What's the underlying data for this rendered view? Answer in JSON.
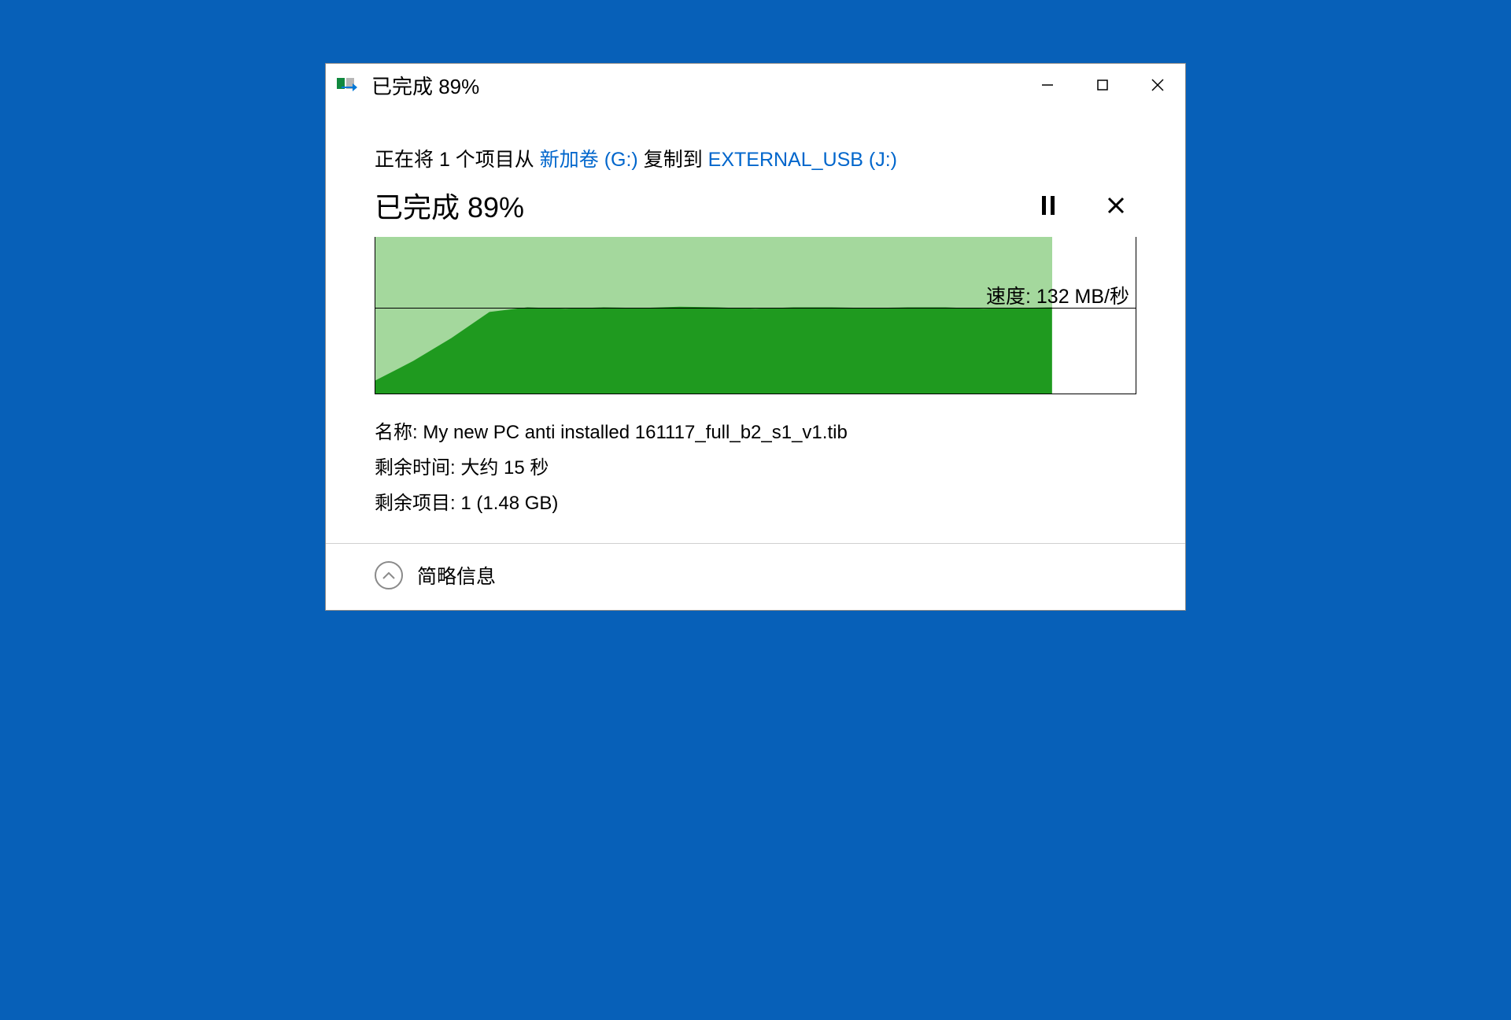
{
  "titlebar": {
    "title": "已完成 89%"
  },
  "copy": {
    "prefix": "正在将 1 个项目从 ",
    "source": "新加卷 (G:)",
    "mid": " 复制到 ",
    "dest": "EXTERNAL_USB (J:)"
  },
  "progress": {
    "label": "已完成 89%",
    "percent": 89
  },
  "chart": {
    "speed_label_prefix": "速度: ",
    "speed_value": "132 MB/秒",
    "speed_line_pct": 46
  },
  "details": {
    "name_label": "名称: ",
    "name_value": "My new PC anti installed 161117_full_b2_s1_v1.tib",
    "time_label": "剩余时间: ",
    "time_value": "大约 15 秒",
    "items_label": "剩余项目: ",
    "items_value": "1 (1.48 GB)"
  },
  "footer": {
    "toggle_label": "简略信息"
  },
  "chart_data": {
    "type": "area",
    "title": "Copy speed over time",
    "xlabel": "",
    "ylabel": "MB/秒",
    "progress_pct": 89,
    "current_speed_mbps": 132,
    "series": [
      {
        "name": "speed",
        "values": [
          20,
          50,
          85,
          125,
          132,
          130,
          132,
          131,
          133,
          132,
          130,
          132,
          132,
          131,
          132,
          132,
          130,
          132
        ]
      }
    ],
    "x": [
      0,
      5,
      10,
      15,
      20,
      25,
      30,
      35,
      40,
      45,
      50,
      55,
      60,
      65,
      70,
      75,
      80,
      89
    ],
    "ylim": [
      0,
      240
    ]
  }
}
